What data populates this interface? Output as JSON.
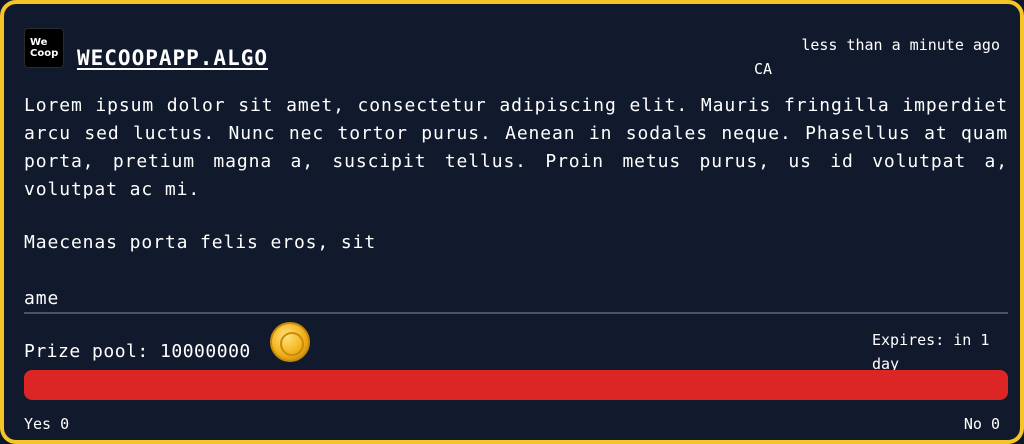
{
  "card": {
    "logo_text": "We\nCoop",
    "title": "WECOOPAPP.ALGO",
    "timestamp": "less than a minute ago",
    "location": "CA",
    "body": "Lorem ipsum dolor sit amet, consectetur adipiscing elit. Mauris fringilla imperdiet arcu sed luctus. Nunc nec tortor purus. Aenean in sodales neque. Phasellus at quam porta, pretium magna a, suscipit tellus. Proin metus purus, us id volutpat a, volutpat ac mi.",
    "body_para2": "Maecenas porta felis eros, sit",
    "body_fragment": "ame",
    "prize_label": "Prize pool: 10000000",
    "coin_icon": "algo-coin-icon",
    "expires": "Expires: in 1 day",
    "vote_ratio_yes": 0,
    "yes_label": "Yes 0",
    "no_label": "No 0"
  },
  "colors": {
    "border": "#f3c526",
    "background": "#111a2c",
    "bar_no": "#dc2626",
    "bar_yes": "#16a34a",
    "text": "#ffffff"
  }
}
